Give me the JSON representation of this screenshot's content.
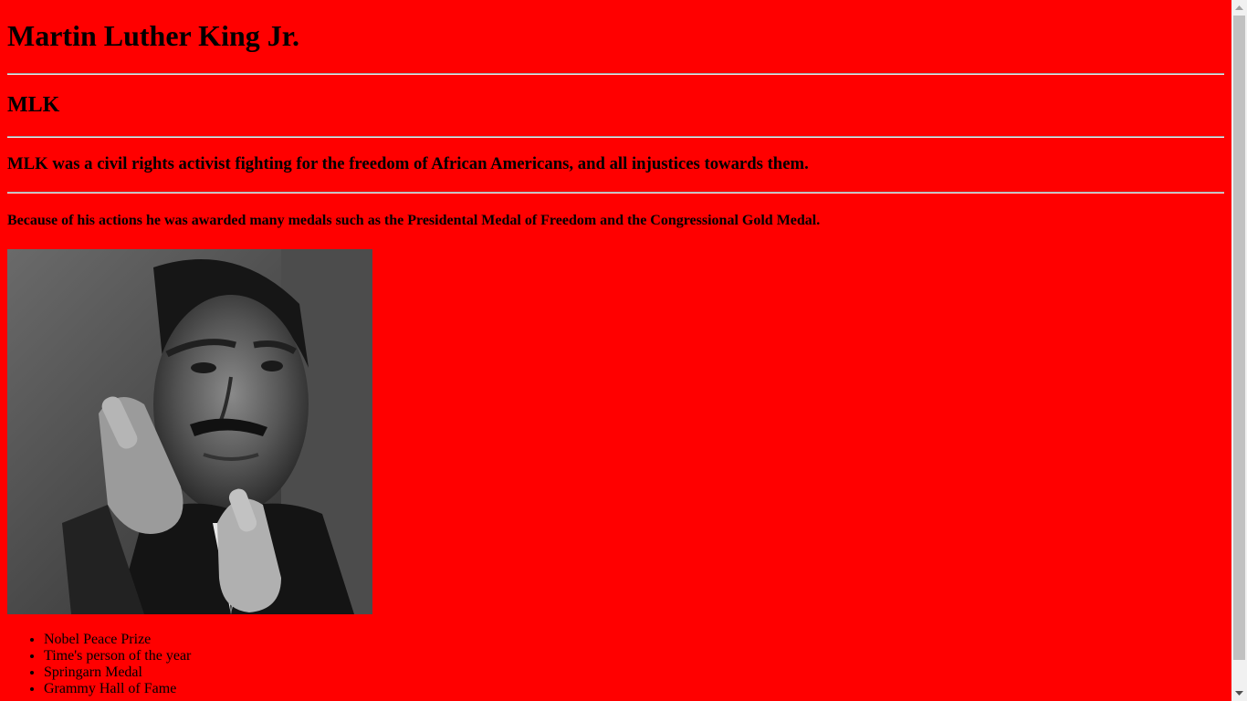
{
  "page": {
    "background_color": "#ff0000",
    "title": "Martin Luther King Jr.",
    "subtitle": "MLK",
    "description": "MLK was a civil rights activist fighting for the freedom of African Americans, and all injustices towards them.",
    "medals_text": "Because of his actions he was awarded many medals such as the Presidental Medal of Freedom and the Congressional Gold Medal.",
    "photo_alt": "Martin Luther King Jr. photo",
    "awards": [
      "Nobel Peace Prize",
      "Time's person of the year",
      "Springarn Medal",
      "Grammy Hall of Fame"
    ]
  },
  "scrollbar": {
    "up_icon": "triangle-up",
    "down_icon": "triangle-down"
  }
}
